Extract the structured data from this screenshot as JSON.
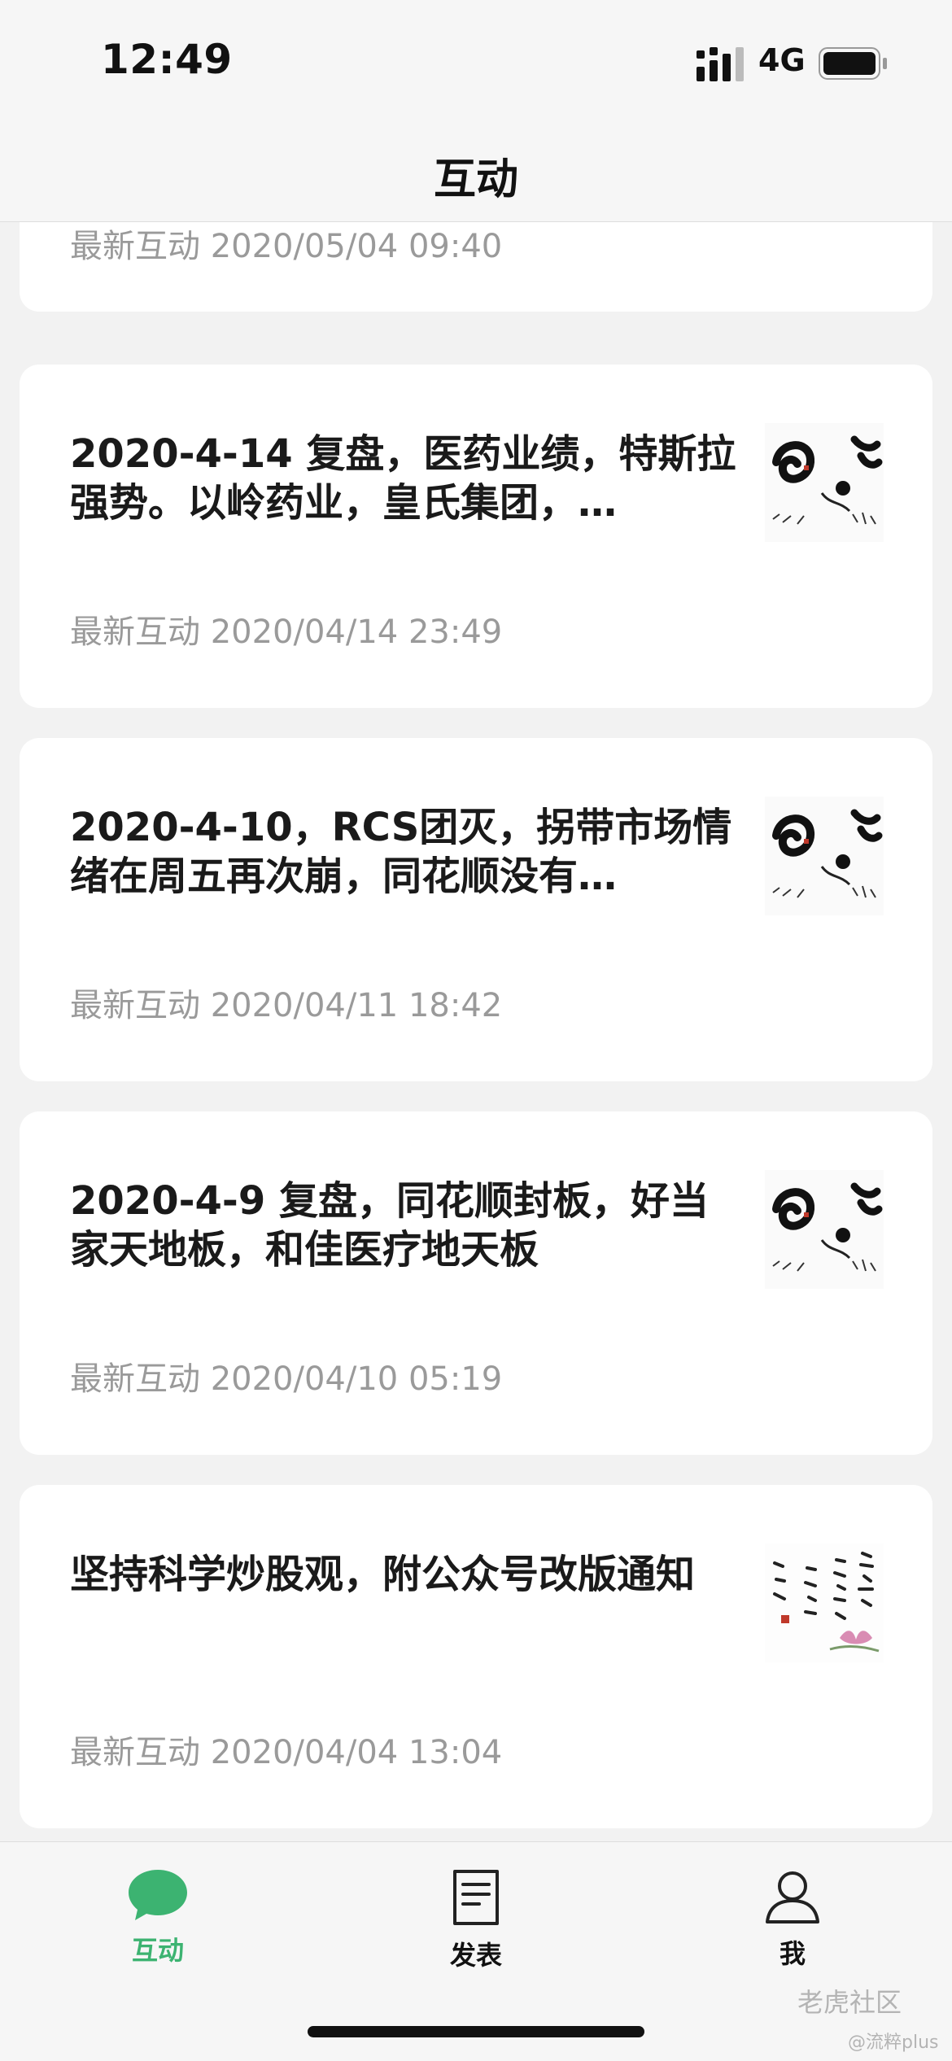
{
  "status_bar": {
    "time": "12:49",
    "network": "4G"
  },
  "header": {
    "title": "互动"
  },
  "partial_card": {
    "meta": "最新互动 2020/05/04 09:40"
  },
  "cards": [
    {
      "title": "2020-4-14 复盘，医药业绩，特斯拉强势。以岭药业，皇氏集团，…",
      "meta": "最新互动 2020/04/14 23:49",
      "thumbnail": "calligraphy-thumbnail"
    },
    {
      "title": "2020-4-10，RCS团灭，拐带市场情绪在周五再次崩，同花顺没有…",
      "meta": "最新互动 2020/04/11 18:42",
      "thumbnail": "calligraphy-thumbnail"
    },
    {
      "title": "2020-4-9 复盘，同花顺封板，好当家天地板，和佳医疗地天板",
      "meta": "最新互动 2020/04/10 05:19",
      "thumbnail": "calligraphy-thumbnail"
    },
    {
      "title": "坚持科学炒股观，附公众号改版通知",
      "meta": "最新互动 2020/04/04 13:04",
      "thumbnail": "calligraphy-lotus-thumbnail"
    }
  ],
  "tabbar": {
    "items": [
      {
        "label": "互动",
        "icon": "chat-bubble-icon",
        "active": true
      },
      {
        "label": "发表",
        "icon": "document-icon",
        "active": false
      },
      {
        "label": "我",
        "icon": "person-icon",
        "active": false
      }
    ]
  },
  "watermark": {
    "text": "老虎社区",
    "sub": "@流粹plus"
  },
  "colors": {
    "accent": "#3cb371",
    "meta_text": "#9a9a9a",
    "background": "#f2f2f2"
  }
}
